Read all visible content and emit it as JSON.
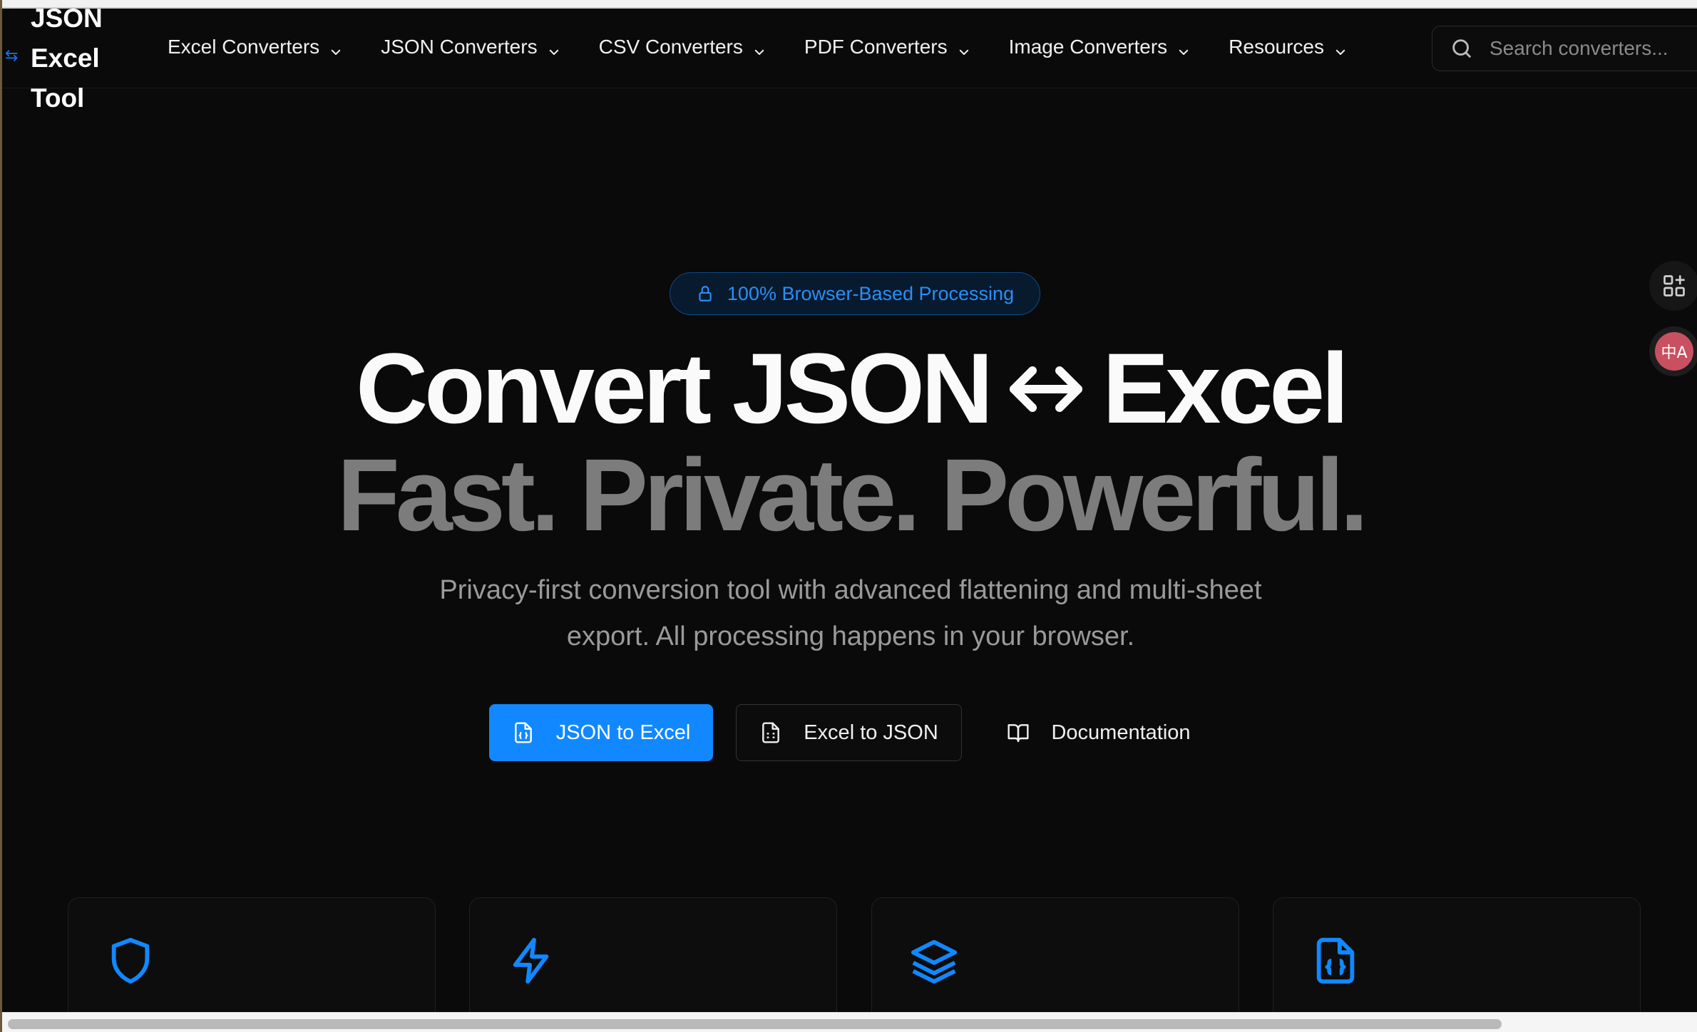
{
  "brand": {
    "logo_lines": [
      "JSON",
      "Excel",
      "Tool"
    ],
    "accent_color": "#1188ff"
  },
  "nav": {
    "items": [
      {
        "label": "Excel Converters",
        "icon": "chevron-down-icon"
      },
      {
        "label": "JSON Converters",
        "icon": "chevron-down-icon"
      },
      {
        "label": "CSV Converters",
        "icon": "chevron-down-icon"
      },
      {
        "label": "PDF Converters",
        "icon": "chevron-down-icon"
      },
      {
        "label": "Image Converters",
        "icon": "chevron-down-icon"
      },
      {
        "label": "Resources",
        "icon": "chevron-down-icon"
      }
    ]
  },
  "search": {
    "placeholder": "Search converters...",
    "value": ""
  },
  "side_tools": {
    "apps_icon": "apps-sparkle-icon",
    "translate_label": "中A"
  },
  "hero": {
    "badge": "100% Browser-Based Processing",
    "title_left": "Convert JSON",
    "title_right": "Excel",
    "subtitle": "Fast. Private. Powerful.",
    "description": "Privacy-first conversion tool with advanced flattening and multi-sheet export. All processing happens in your browser."
  },
  "actions": {
    "primary": {
      "label": "JSON to Excel",
      "icon": "file-json-icon"
    },
    "secondary": {
      "label": "Excel to JSON",
      "icon": "file-spreadsheet-icon"
    },
    "docs": {
      "label": "Documentation",
      "icon": "book-open-icon"
    }
  },
  "features": [
    {
      "icon": "shield-icon"
    },
    {
      "icon": "lightning-icon"
    },
    {
      "icon": "layers-icon"
    },
    {
      "icon": "file-code-icon"
    }
  ],
  "colors": {
    "background": "#0a0a0a",
    "badge_text": "#2b8ff5",
    "muted_heading": "#7c7c7c"
  }
}
